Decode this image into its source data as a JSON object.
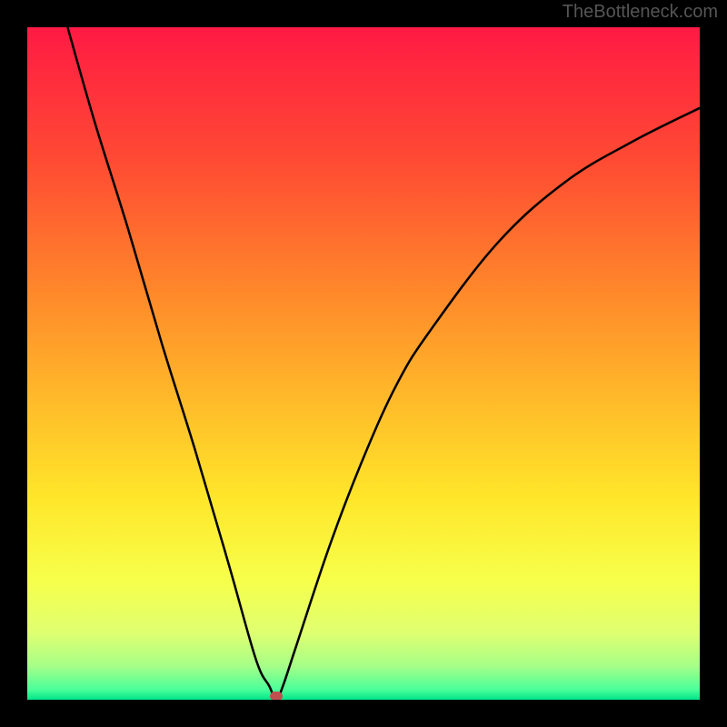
{
  "watermark": "TheBottleneck.com",
  "chart_data": {
    "type": "line",
    "title": "",
    "xlabel": "",
    "ylabel": "",
    "xlim": [
      0,
      100
    ],
    "ylim": [
      0,
      100
    ],
    "series": [
      {
        "name": "bottleneck-curve",
        "x": [
          6,
          10,
          15,
          20,
          25,
          30,
          34,
          36,
          37,
          38,
          40,
          45,
          50,
          55,
          60,
          70,
          80,
          90,
          100
        ],
        "y": [
          100,
          86,
          70,
          53,
          37,
          20,
          6,
          2,
          0,
          2,
          8,
          23,
          36,
          47,
          55,
          68,
          77,
          83,
          88
        ]
      }
    ],
    "marker": {
      "x": 37,
      "y": 0.5,
      "color": "#c05050"
    },
    "background_gradient": {
      "type": "vertical",
      "stops": [
        {
          "pos": 0.0,
          "color": "#ff1a44"
        },
        {
          "pos": 0.2,
          "color": "#ff4b33"
        },
        {
          "pos": 0.4,
          "color": "#ff8a2a"
        },
        {
          "pos": 0.55,
          "color": "#ffb92a"
        },
        {
          "pos": 0.7,
          "color": "#ffe62a"
        },
        {
          "pos": 0.82,
          "color": "#f7ff4a"
        },
        {
          "pos": 0.9,
          "color": "#e0ff70"
        },
        {
          "pos": 0.95,
          "color": "#a6ff88"
        },
        {
          "pos": 0.985,
          "color": "#4aff9a"
        },
        {
          "pos": 1.0,
          "color": "#00e58a"
        }
      ]
    }
  }
}
